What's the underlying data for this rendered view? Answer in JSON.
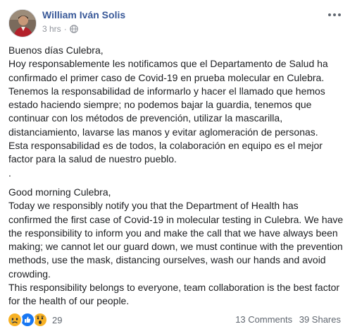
{
  "post": {
    "author": "William Iván Solis",
    "timestamp": "3 hrs",
    "separator": "·",
    "privacy_icon": "globe-icon",
    "more_icon": "more-options-icon",
    "body_es": [
      "Buenos días Culebra,",
      "Hoy responsablemente les notificamos que el Departamento de Salud ha confirmado el primer caso de Covid-19 en prueba molecular en Culebra.",
      "Tenemos la responsabilidad de informarlo y hacer el llamado que hemos estado haciendo siempre; no podemos bajar la guardia, tenemos que continuar con los métodos de prevención, utilizar la mascarilla, distanciamiento, lavarse las manos y evitar aglomeración de personas.",
      "Esta responsabilidad es de todos, la colaboración en equipo es el mejor factor para la salud de nuestro pueblo.",
      "."
    ],
    "body_en": [
      "Good morning Culebra,",
      "Today we responsibly notify you that the Department of Health has confirmed the first case of Covid-19 in molecular testing in Culebra. We have the responsibility to inform you and make the call that we have always been making; we cannot let our guard down, we must continue with the prevention methods, use the mask, distancing ourselves, wash our hands and avoid crowding.",
      "This responsibility belongs to everyone, team collaboration is the best factor for the health of our people."
    ]
  },
  "footer": {
    "reactions": [
      "sad",
      "like",
      "wow"
    ],
    "reaction_count": "29",
    "comments": "13 Comments",
    "shares": "39 Shares"
  },
  "colors": {
    "author": "#385898",
    "meta": "#90949c",
    "like": "#1877f2",
    "emoji": "#f7b125"
  }
}
